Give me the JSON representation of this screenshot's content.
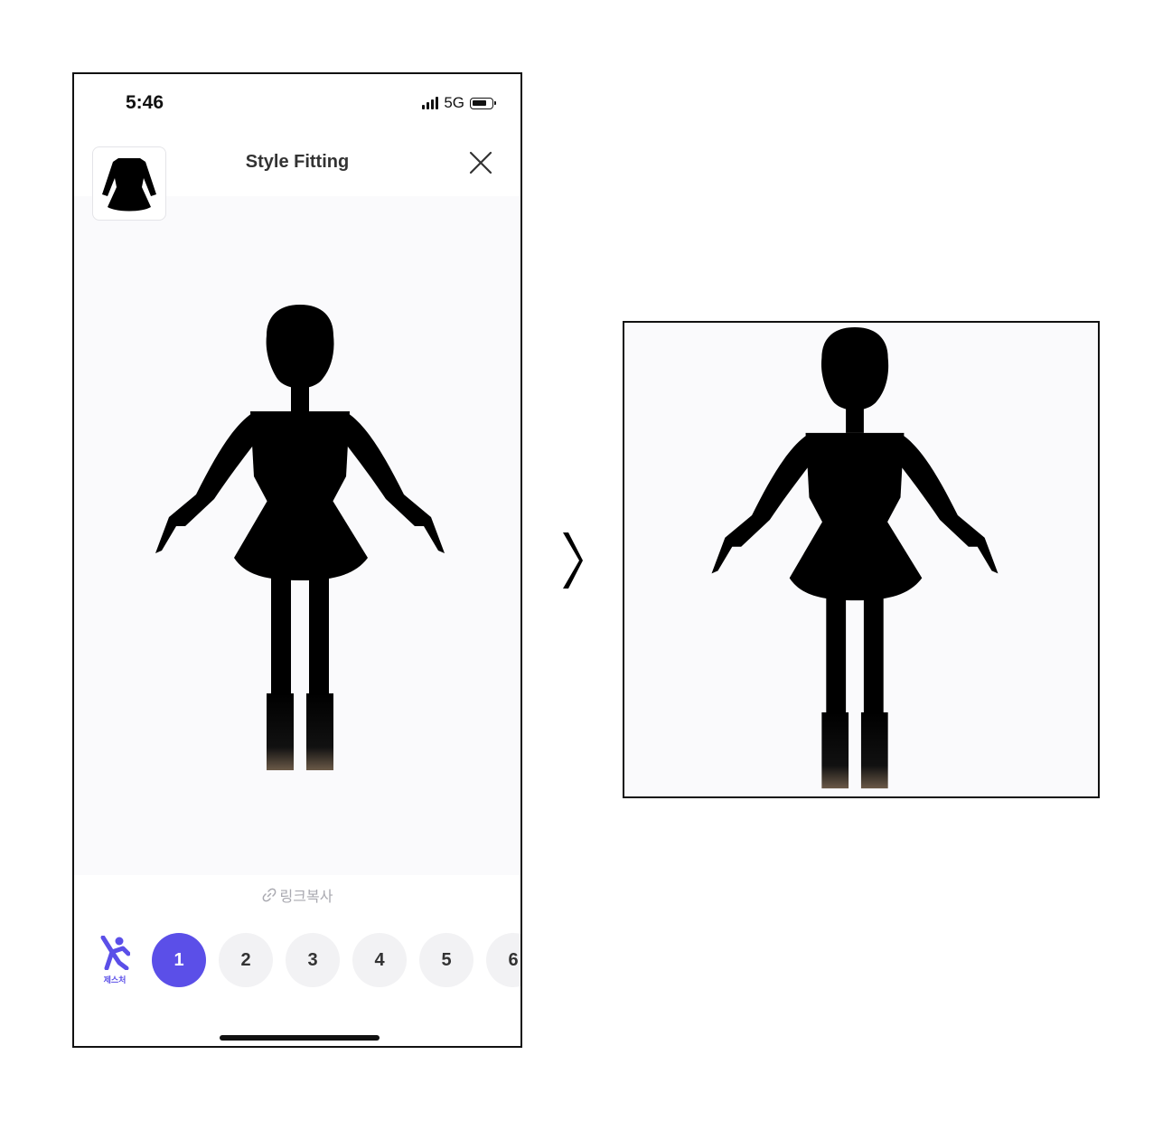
{
  "status_bar": {
    "time": "5:46",
    "network": "5G"
  },
  "header": {
    "title": "Style Fitting"
  },
  "thumbnail": {
    "icon": "dress-icon"
  },
  "close": {
    "icon": "close-icon"
  },
  "link_copy": {
    "label": "링크복사",
    "icon": "link-icon"
  },
  "gesture": {
    "label": "제스처",
    "icon": "gesture-icon"
  },
  "poses": [
    {
      "label": "1",
      "active": true
    },
    {
      "label": "2"
    },
    {
      "label": "3"
    },
    {
      "label": "4"
    },
    {
      "label": "5"
    },
    {
      "label": "6"
    }
  ],
  "arrow": {
    "icon": "chevron-right-icon"
  },
  "colors": {
    "accent": "#5b4fe8",
    "viewer_bg": "#fafafc",
    "pill_bg": "#f2f2f4"
  }
}
